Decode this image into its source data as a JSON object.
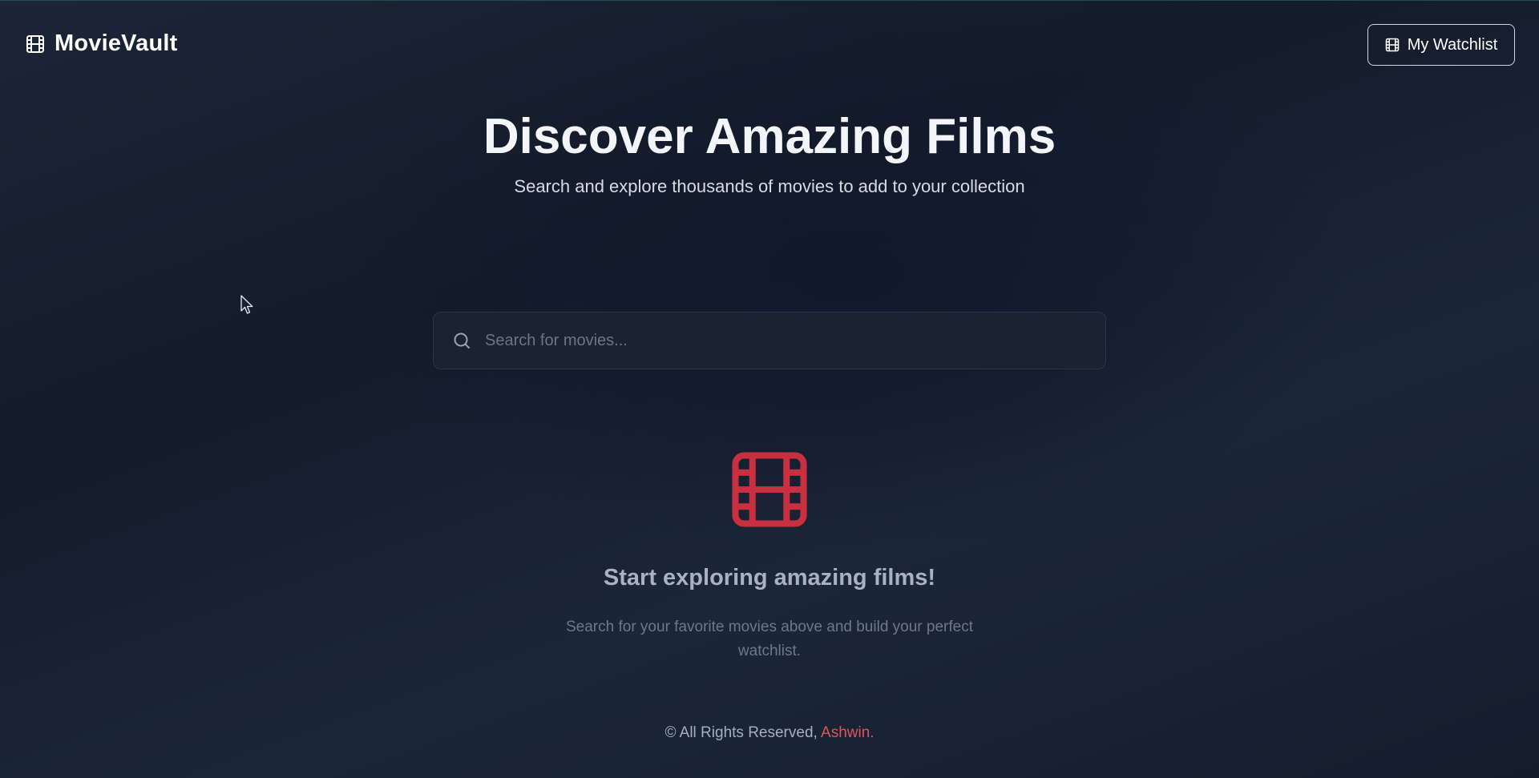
{
  "header": {
    "brand_icon": "film-icon",
    "brand_name": "MovieVault",
    "watchlist_icon": "film-icon",
    "watchlist_label": "My Watchlist"
  },
  "hero": {
    "title": "Discover Amazing Films",
    "subtitle": "Search and explore thousands of movies to add to your collection"
  },
  "search": {
    "icon": "search-icon",
    "placeholder": "Search for movies...",
    "value": ""
  },
  "empty_state": {
    "icon": "film-icon",
    "title": "Start exploring amazing films!",
    "text": "Search for your favorite movies above and build your perfect watchlist."
  },
  "footer": {
    "text": "© All Rights Reserved, ",
    "author": "Ashwin",
    "suffix": "."
  },
  "colors": {
    "background": "#141c2b",
    "accent_red": "#c9303f",
    "author_red": "#e0545f",
    "text_primary": "#f3f5f8",
    "text_muted": "#6f7888"
  }
}
